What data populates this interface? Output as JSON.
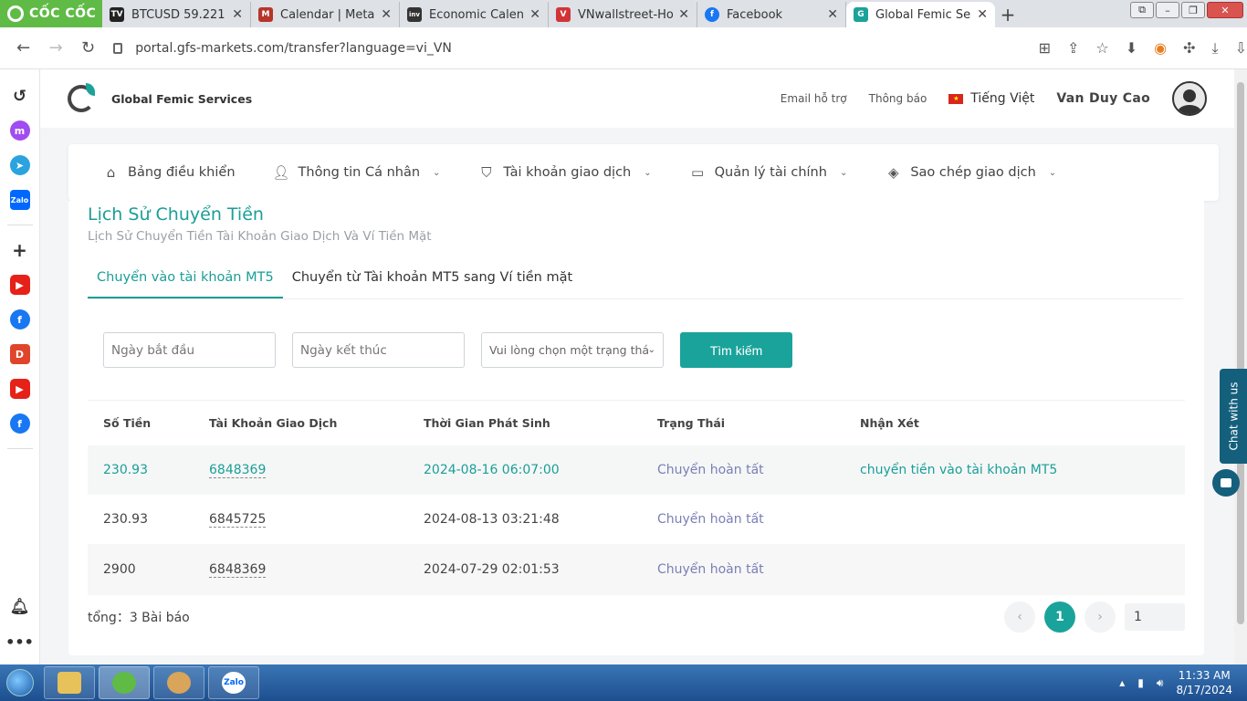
{
  "browser": {
    "brand": "CỐC CỐC",
    "tabs": [
      {
        "title": "BTCUSD 59.221 ↗",
        "icon_color": "#222222",
        "icon_text": "TV"
      },
      {
        "title": "Calendar | Metal",
        "icon_color": "#b5352b",
        "icon_text": "M"
      },
      {
        "title": "Economic Calenc",
        "icon_color": "#333333",
        "icon_text": "inv"
      },
      {
        "title": "VNwallstreet-Ho",
        "icon_color": "#d13438",
        "icon_text": "V"
      },
      {
        "title": "Facebook",
        "icon_color": "#1877f2",
        "icon_text": "f"
      },
      {
        "title": "Global Femic Ser",
        "icon_color": "#1aa39a",
        "icon_text": "G"
      }
    ],
    "url": "portal.gfs-markets.com/transfer?language=vi_VN"
  },
  "header": {
    "company": "Global Femic Services",
    "support_email": "Email hỗ trợ",
    "notifications": "Thông báo",
    "language": "Tiếng Việt",
    "user_name": "Van Duy Cao"
  },
  "menu": {
    "items": [
      {
        "label": "Bảng điều khiển",
        "has_dropdown": false
      },
      {
        "label": "Thông tin Cá nhân",
        "has_dropdown": true
      },
      {
        "label": "Tài khoản giao dịch",
        "has_dropdown": true
      },
      {
        "label": "Quản lý tài chính",
        "has_dropdown": true
      },
      {
        "label": "Sao chép giao dịch",
        "has_dropdown": true
      }
    ]
  },
  "content": {
    "title": "Lịch Sử Chuyển Tiền",
    "subtitle": "Lịch Sử Chuyển Tiền Tài Khoản Giao Dịch Và Ví Tiền Mặt",
    "tabs": [
      {
        "label": "Chuyển vào tài khoản MT5",
        "active": true
      },
      {
        "label": "Chuyển từ Tài khoản MT5 sang Ví tiền mặt",
        "active": false
      }
    ]
  },
  "filters": {
    "start_date_placeholder": "Ngày bắt đầu",
    "end_date_placeholder": "Ngày kết thúc",
    "status_placeholder": "Vui lòng chọn một trạng thái",
    "search_label": "Tìm kiếm"
  },
  "table": {
    "headers": [
      "Số Tiền",
      "Tài Khoản Giao Dịch",
      "Thời Gian Phát Sinh",
      "Trạng Thái",
      "Nhận Xét"
    ],
    "rows": [
      {
        "amount": "230.93",
        "account": "6848369",
        "time": "2024-08-16 06:07:00",
        "status": "Chuyển hoàn tất",
        "note": "chuyển tiền vào tài khoản MT5"
      },
      {
        "amount": "230.93",
        "account": "6845725",
        "time": "2024-08-13 03:21:48",
        "status": "Chuyển hoàn tất",
        "note": ""
      },
      {
        "amount": "2900",
        "account": "6848369",
        "time": "2024-07-29 02:01:53",
        "status": "Chuyển hoàn tất",
        "note": ""
      }
    ]
  },
  "footer": {
    "total": "tổng：3 Bài báo",
    "current_page": "1",
    "page_input": "1",
    "prev": "‹",
    "next": "›"
  },
  "chat": {
    "label": "Chat with us"
  },
  "taskbar": {
    "time": "11:33 AM",
    "date": "8/17/2024",
    "zalo": "Zalo"
  },
  "colors": {
    "accent": "#1aa39a",
    "status": "#7a7fb5",
    "chat": "#145f7c"
  }
}
